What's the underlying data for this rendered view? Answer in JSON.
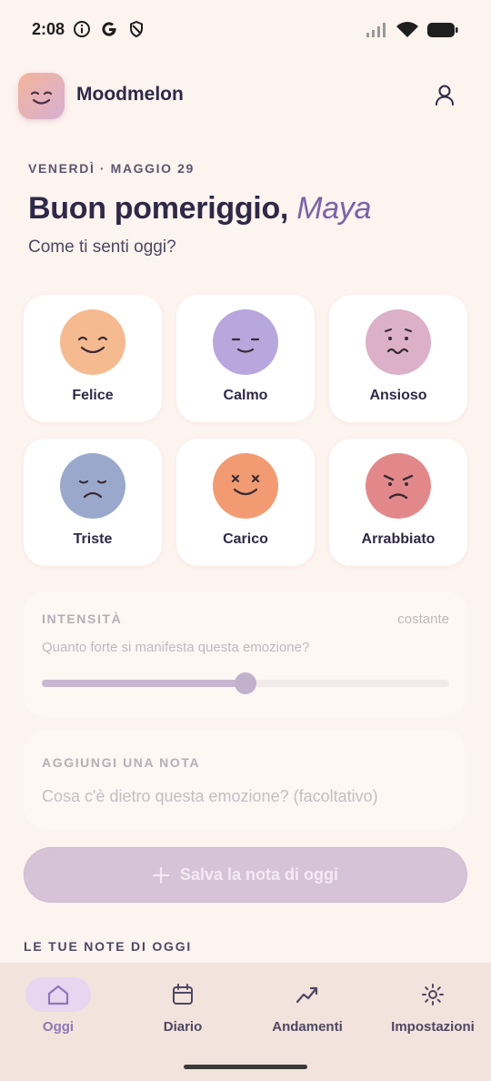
{
  "status_bar": {
    "time": "2:08",
    "icons": [
      "info-circle-icon",
      "google-g-icon",
      "shield-icon",
      "cell-signal-icon",
      "wifi-icon",
      "battery-icon"
    ]
  },
  "header": {
    "app_name": "Moodmelon",
    "logo_icon": "smiling-face-icon",
    "profile_icon": "person-icon"
  },
  "date_label": "VENERDÌ · MAGGIO 29",
  "greeting": {
    "prefix": "Buon pomeriggio,",
    "name": "Maya"
  },
  "question": "Come ti senti oggi?",
  "moods": [
    {
      "label": "Felice",
      "color": "#f6ba91",
      "icon": "happy-face-icon"
    },
    {
      "label": "Calmo",
      "color": "#b8a6dc",
      "icon": "calm-face-icon"
    },
    {
      "label": "Ansioso",
      "color": "#dcb0c9",
      "icon": "anxious-face-icon"
    },
    {
      "label": "Triste",
      "color": "#9aa8cc",
      "icon": "sad-face-icon"
    },
    {
      "label": "Carico",
      "color": "#f29b72",
      "icon": "excited-face-icon"
    },
    {
      "label": "Arrabbiato",
      "color": "#e3888a",
      "icon": "angry-face-icon"
    }
  ],
  "intensity": {
    "title": "INTENSITÀ",
    "value_text": "costante",
    "question": "Quanto forte si manifesta questa emozione?",
    "level": 0.5
  },
  "note": {
    "title": "AGGIUNGI UNA NOTA",
    "placeholder": "Cosa c'è dietro questa emozione? (facoltativo)"
  },
  "save_button": {
    "label": "Salva la nota di oggi",
    "icon": "plus-icon"
  },
  "today_notes_title": "LE TUE NOTE DI OGGI",
  "bottom_nav": [
    {
      "label": "Oggi",
      "icon": "home-icon",
      "active": true
    },
    {
      "label": "Diario",
      "icon": "calendar-icon",
      "active": false
    },
    {
      "label": "Andamenti",
      "icon": "trend-line-icon",
      "active": false
    },
    {
      "label": "Impostazioni",
      "icon": "sun-gear-icon",
      "active": false
    }
  ],
  "colors": {
    "background": "#fdf3ef",
    "accent": "#7b62a8",
    "nav_background": "#f2e3dc"
  }
}
